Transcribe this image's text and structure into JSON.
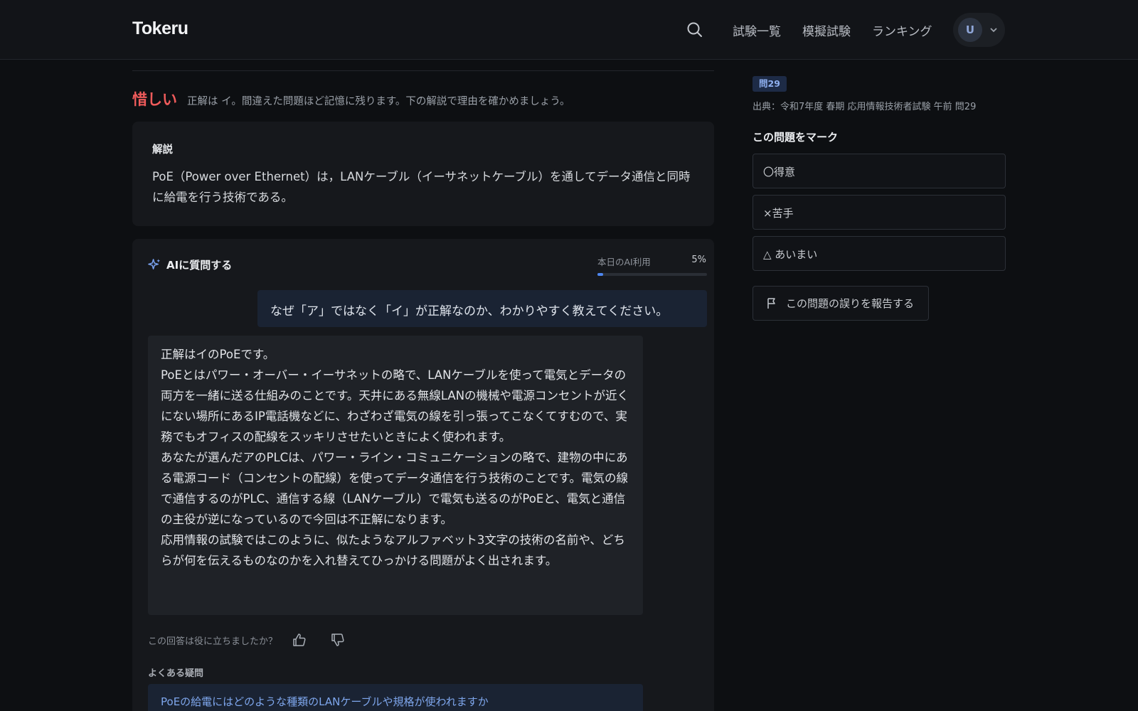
{
  "header": {
    "logo": "Tokeru",
    "nav": [
      "試験一覧",
      "模擬試験",
      "ランキング"
    ],
    "avatar_initial": "U"
  },
  "result": {
    "label": "惜しい",
    "message": "正解は イ。間違えた問題ほど記憶に残ります。下の解説で理由を確かめましょう。"
  },
  "explanation": {
    "title": "解説",
    "body": "PoE（Power over Ethernet）は，LANケーブル（イーサネットケーブル）を通してデータ通信と同時に給電を行う技術である。"
  },
  "ai": {
    "title": "AIに質問する",
    "usage_label": "本日のAI利用",
    "usage_percent": "5%",
    "usage_fraction": 0.05,
    "user_question": "なぜ「ア」ではなく「イ」が正解なのか、わかりやすく教えてください。",
    "answer": [
      "正解はイのPoEです。",
      "PoEとはパワー・オーバー・イーサネットの略で、LANケーブルを使って電気とデータの両方を一緒に送る仕組みのことです。天井にある無線LANの機械や電源コンセントが近くにない場所にあるIP電話機などに、わざわざ電気の線を引っ張ってこなくてすむので、実務でもオフィスの配線をスッキリさせたいときによく使われます。",
      "あなたが選んだアのPLCは、パワー・ライン・コミュニケーションの略で、建物の中にある電源コード（コンセントの配線）を使ってデータ通信を行う技術のことです。電気の線で通信するのがPLC、通信する線（LANケーブル）で電気も送るのがPoEと、電気と通信の主役が逆になっているので今回は不正解になります。",
      "応用情報の試験ではこのように、似たようなアルファベット3文字の技術の名前や、どちらが何を伝えるものなのかを入れ替えてひっかける問題がよく出されます。"
    ],
    "feedback_prompt": "この回答は役に立ちましたか？",
    "faq_label": "よくある疑問",
    "faq_items": [
      "PoEの給電にはどのような種類のLANケーブルや規格が使われますか"
    ]
  },
  "sidebar": {
    "question_badge": "問29",
    "source": "出典：令和7年度 春期 応用情報技術者試験 午前 問29",
    "mark_title": "この問題をマーク",
    "mark_options": [
      "〇得意",
      "×苦手",
      "△ あいまい"
    ],
    "report_label": "この問題の誤りを報告する"
  },
  "colors": {
    "background": "#0d0f12",
    "accent_blue": "#4d86f0",
    "result_red": "#ef5b5b"
  },
  "icons": [
    "search-icon",
    "chevron-down-icon",
    "sparkle-icon",
    "thumbs-up-icon",
    "thumbs-down-icon",
    "flag-icon"
  ]
}
